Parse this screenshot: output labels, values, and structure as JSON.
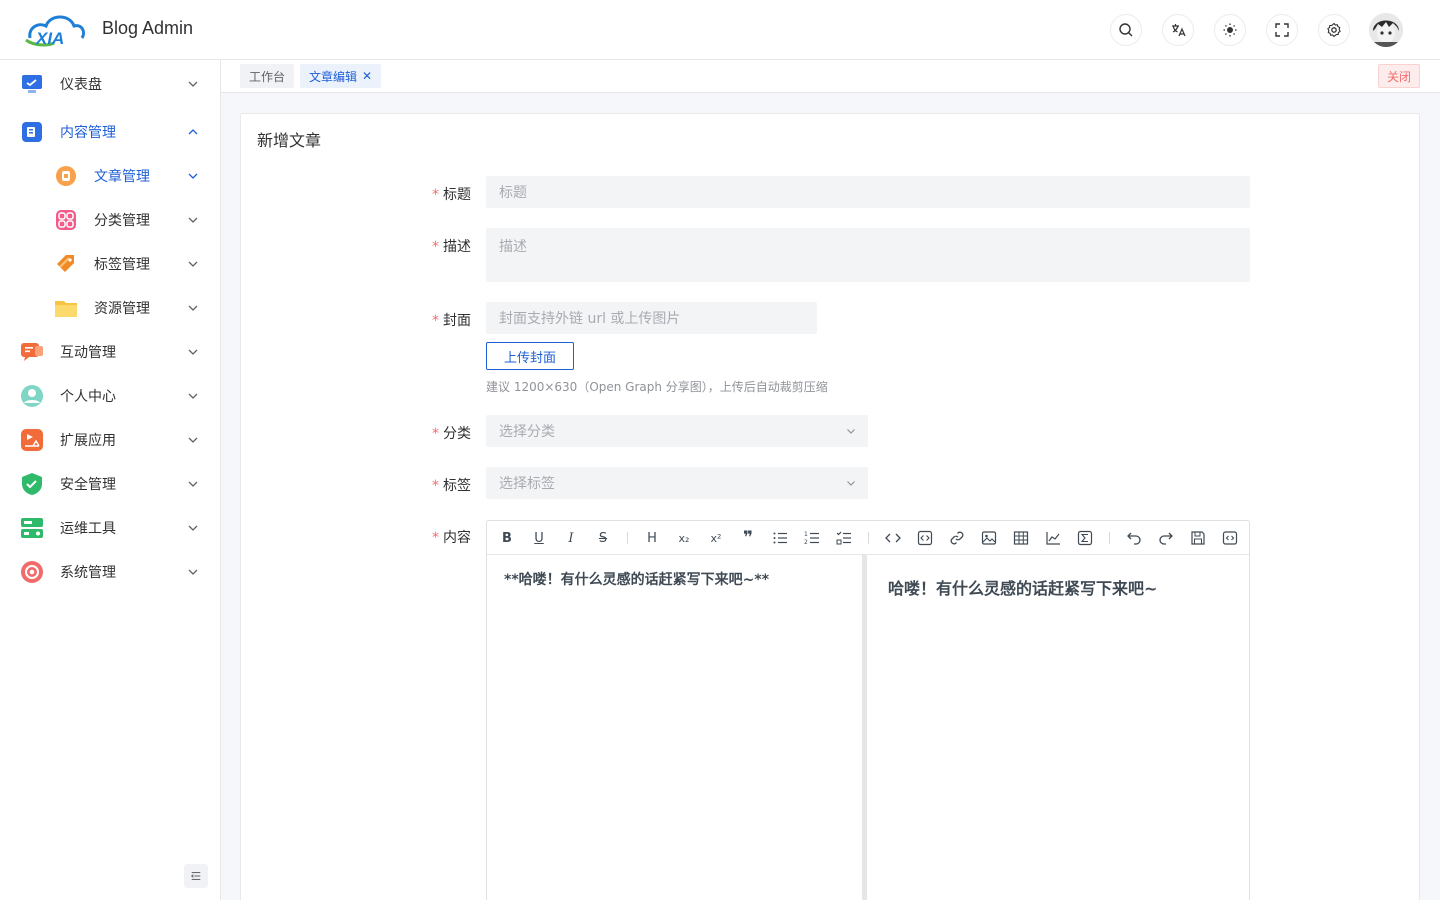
{
  "app": {
    "title": "Blog Admin",
    "logo_text": "XIA"
  },
  "header": {
    "icons": [
      "search-icon",
      "translate-icon",
      "theme-icon",
      "fullscreen-icon",
      "settings-icon"
    ]
  },
  "sidebar": {
    "items": [
      {
        "label": "仪表盘",
        "icon": "dashboard-icon",
        "expanded": false
      },
      {
        "label": "内容管理",
        "icon": "content-icon",
        "expanded": true,
        "active": true
      },
      {
        "label": "文章管理",
        "icon": "article-icon",
        "active": true,
        "sub": true
      },
      {
        "label": "分类管理",
        "icon": "category-icon",
        "sub": true
      },
      {
        "label": "标签管理",
        "icon": "tag-icon",
        "sub": true
      },
      {
        "label": "资源管理",
        "icon": "folder-icon",
        "sub": true
      },
      {
        "label": "互动管理",
        "icon": "interaction-icon"
      },
      {
        "label": "个人中心",
        "icon": "user-icon"
      },
      {
        "label": "扩展应用",
        "icon": "extension-icon"
      },
      {
        "label": "安全管理",
        "icon": "shield-icon"
      },
      {
        "label": "运维工具",
        "icon": "ops-icon"
      },
      {
        "label": "系统管理",
        "icon": "system-icon"
      }
    ]
  },
  "tabs": {
    "home": "工作台",
    "active": "文章编辑",
    "close_all": "关闭"
  },
  "form": {
    "card_title": "新增文章",
    "title": {
      "label": "标题",
      "placeholder": "标题"
    },
    "description": {
      "label": "描述",
      "placeholder": "描述"
    },
    "cover": {
      "label": "封面",
      "placeholder": "封面支持外链 url 或上传图片",
      "upload_button": "上传封面",
      "hint": "建议 1200×630（Open Graph 分享图），上传后自动裁剪压缩"
    },
    "category": {
      "label": "分类",
      "placeholder": "选择分类"
    },
    "tags": {
      "label": "标签",
      "placeholder": "选择标签"
    },
    "content": {
      "label": "内容",
      "source": "**哈喽！有什么灵感的话赶紧写下来吧~**",
      "preview": "哈喽！有什么灵感的话赶紧写下来吧~"
    }
  },
  "editor_toolbar": [
    "B",
    "U",
    "I",
    "S",
    "H",
    "x₂",
    "x²",
    "quote",
    "ul",
    "ol",
    "task",
    "code",
    "code-block",
    "link",
    "image",
    "table",
    "chart",
    "formula",
    "undo",
    "redo",
    "save",
    "preview"
  ],
  "colors": {
    "accent": "#1f5fd6",
    "required": "#f56c6c",
    "input_bg": "#f3f4f6"
  }
}
